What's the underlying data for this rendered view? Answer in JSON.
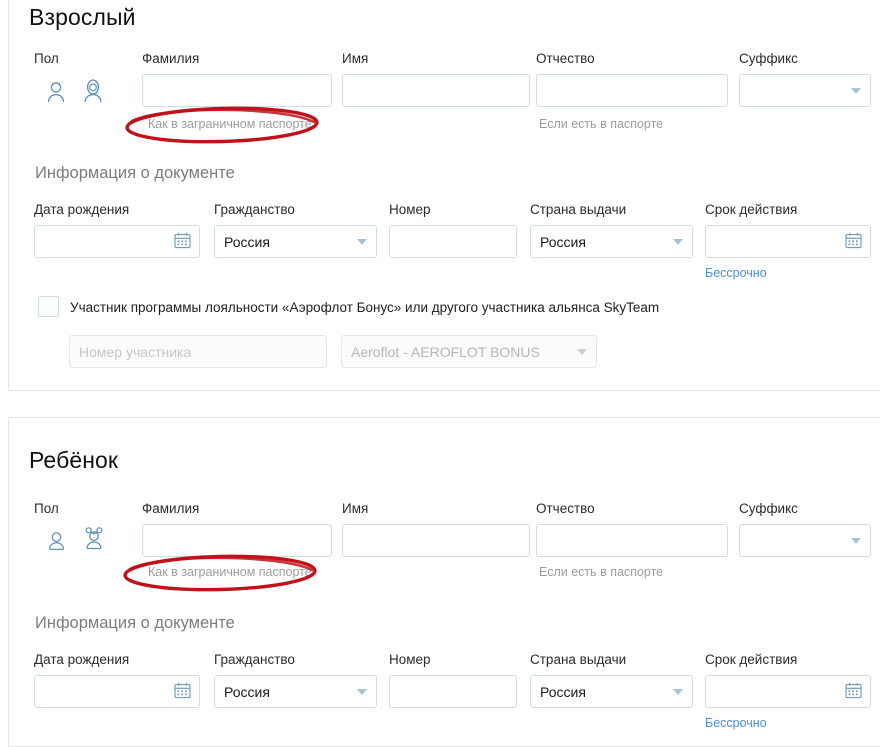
{
  "adult": {
    "title": "Взрослый",
    "gender_label": "Пол",
    "gender_options": [
      {
        "name": "male-gender-icon",
        "selected": false
      },
      {
        "name": "female-gender-icon",
        "selected": false
      }
    ],
    "name_fields": [
      {
        "label": "Фамилия",
        "value": "",
        "placeholder": "",
        "hint": "Как в заграничном паспорте"
      },
      {
        "label": "Имя",
        "value": "",
        "placeholder": "",
        "hint": ""
      },
      {
        "label": "Отчество",
        "value": "",
        "placeholder": "",
        "hint": "Если есть в паспорте"
      }
    ],
    "suffix": {
      "label": "Суффикс",
      "value": ""
    },
    "document_section_title": "Информация о документе",
    "document_fields": {
      "birth_date": {
        "label": "Дата рождения",
        "value": "",
        "icon": "calendar-icon"
      },
      "citizenship": {
        "label": "Гражданство",
        "value": "Россия"
      },
      "number": {
        "label": "Номер",
        "value": ""
      },
      "issuing_country": {
        "label": "Страна выдачи",
        "value": "Россия"
      },
      "expiry": {
        "label": "Срок действия",
        "value": "",
        "icon": "calendar-icon",
        "link": "Бессрочно"
      }
    },
    "loyalty": {
      "checkbox_label": "Участник программы лояльности «Аэрофлот Бонус» или другого участника альянса SkyTeam",
      "checked": false,
      "member_number_placeholder": "Номер участника",
      "member_number_value": "",
      "program_value": "Aeroflot - AEROFLOT BONUS"
    }
  },
  "child": {
    "title": "Ребёнок",
    "gender_label": "Пол",
    "gender_options": [
      {
        "name": "boy-gender-icon",
        "selected": false
      },
      {
        "name": "girl-gender-icon",
        "selected": false
      }
    ],
    "name_fields": [
      {
        "label": "Фамилия",
        "value": "",
        "placeholder": "",
        "hint": "Как в заграничном паспорте"
      },
      {
        "label": "Имя",
        "value": "",
        "placeholder": "",
        "hint": ""
      },
      {
        "label": "Отчество",
        "value": "",
        "placeholder": "",
        "hint": "Если есть в паспорте"
      }
    ],
    "suffix": {
      "label": "Суффикс",
      "value": ""
    },
    "document_section_title": "Информация о документе",
    "document_fields": {
      "birth_date": {
        "label": "Дата рождения",
        "value": "",
        "icon": "calendar-icon"
      },
      "citizenship": {
        "label": "Гражданство",
        "value": "Россия"
      },
      "number": {
        "label": "Номер",
        "value": ""
      },
      "issuing_country": {
        "label": "Страна выдачи",
        "value": "Россия"
      },
      "expiry": {
        "label": "Срок действия",
        "value": "",
        "icon": "calendar-icon",
        "link": "Бессрочно"
      }
    }
  },
  "annotations": [
    {
      "name": "red-ellipse-adult-passport-hint",
      "color": "#c0121a"
    },
    {
      "name": "red-ellipse-child-passport-hint",
      "color": "#c0121a"
    }
  ],
  "colors": {
    "accent_link": "#4a90d9",
    "field_border": "#cfdde4",
    "annotation_red": "#c0121a",
    "icon_blue": "#5b8fb5"
  }
}
